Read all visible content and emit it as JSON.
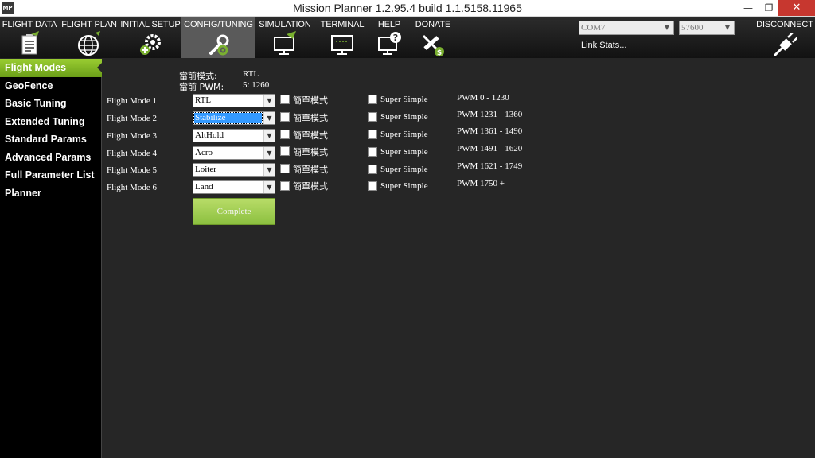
{
  "window": {
    "title": "Mission Planner 1.2.95.4 build 1.1.5158.11965",
    "logo": "MP",
    "min": "—",
    "max": "❐",
    "close": "✕"
  },
  "toolbar": {
    "items": [
      {
        "label": "FLIGHT DATA",
        "icon": "clipboard-icon"
      },
      {
        "label": "FLIGHT PLAN",
        "icon": "globe-icon"
      },
      {
        "label": "INITIAL SETUP",
        "icon": "gear-plus-icon"
      },
      {
        "label": "CONFIG/TUNING",
        "icon": "wrench-icon"
      },
      {
        "label": "SIMULATION",
        "icon": "monitor-plane-icon"
      },
      {
        "label": "TERMINAL",
        "icon": "terminal-icon"
      },
      {
        "label": "HELP",
        "icon": "help-icon"
      },
      {
        "label": "DONATE",
        "icon": "donate-icon"
      }
    ],
    "port": "COM7",
    "baud": "57600",
    "link_stats": "Link Stats...",
    "disconnect": "DISCONNECT",
    "accent": "#9acd32"
  },
  "sidebar": {
    "items": [
      "Flight Modes",
      "GeoFence",
      "Basic Tuning",
      "Extended Tuning",
      "Standard Params",
      "Advanced Params",
      "Full Parameter List",
      "Planner"
    ]
  },
  "flight_modes": {
    "current_mode_label": "當前模式:",
    "current_mode_value": "RTL",
    "current_pwm_label": "當前 PWM:",
    "current_pwm_value": "5: 1260",
    "simple_label": "簡單模式",
    "super_simple_label": "Super Simple",
    "rows": [
      {
        "label": "Flight Mode 1",
        "mode": "RTL",
        "pwm": "PWM 0 - 1230"
      },
      {
        "label": "Flight Mode 2",
        "mode": "Stabilize",
        "pwm": "PWM 1231 - 1360"
      },
      {
        "label": "Flight Mode 3",
        "mode": "AltHold",
        "pwm": "PWM 1361 - 1490"
      },
      {
        "label": "Flight Mode 4",
        "mode": "Acro",
        "pwm": "PWM 1491 - 1620"
      },
      {
        "label": "Flight Mode 5",
        "mode": "Loiter",
        "pwm": "PWM 1621 - 1749"
      },
      {
        "label": "Flight Mode 6",
        "mode": "Land",
        "pwm": "PWM 1750 +"
      }
    ],
    "complete_button": "Complete"
  }
}
